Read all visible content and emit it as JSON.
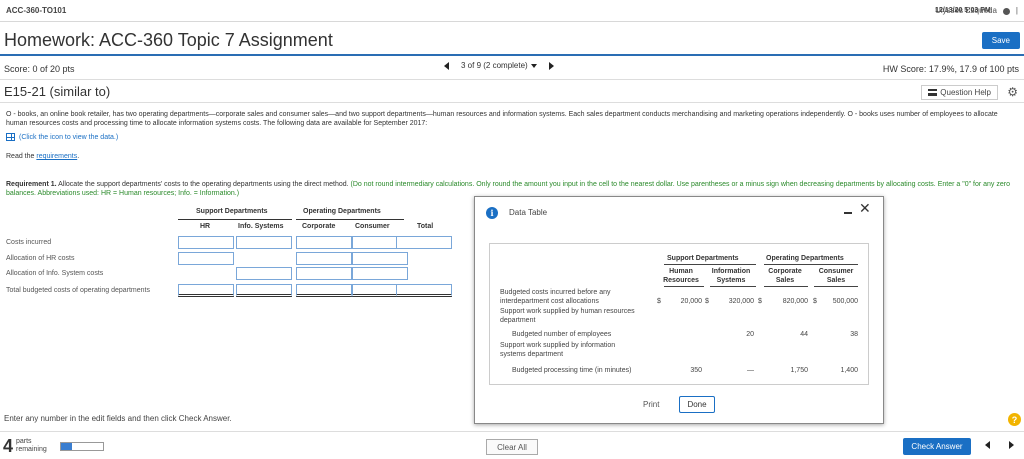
{
  "topbar": {
    "course": "ACC-360-TO101",
    "user": "Ulysses Esqueda",
    "divider": "|",
    "datetime": "12/13/20 5:03 PM"
  },
  "header": {
    "title": "Homework: ACC-360 Topic 7 Assignment",
    "save_label": "Save"
  },
  "scorebar": {
    "score": "Score: 0 of 20 pts",
    "pager": "3 of 9 (2 complete)",
    "hw_score": "HW Score: 17.9%, 17.9 of 100 pts"
  },
  "question": {
    "id": "E15-21 (similar to)",
    "help_label": "Question Help",
    "intro": "O - books, an online book retailer, has two operating departments—corporate sales and consumer sales—and two support departments—human resources and information systems. Each sales department conducts merchandising and marketing operations independently. O - books uses number of employees to allocate human resources costs and processing time to allocate information systems costs. The following data are available for September 2017:",
    "data_link": "(Click the icon to view the data.)",
    "read_prefix": "Read the ",
    "read_link": "requirements",
    "read_suffix": "."
  },
  "requirement": {
    "label": "Requirement 1.",
    "text": " Allocate the support departments' costs to the operating departments using the direct method. ",
    "note": "(Do not round intermediary calculations. Only round the amount you input in the cell to the nearest dollar. Use parentheses or a minus sign when decreasing departments by allocating costs. Enter a \"0\" for any zero balances. Abbreviations used: HR = Human resources; Info. = Information.)"
  },
  "worktable": {
    "group_support": "Support Departments",
    "group_operating": "Operating Departments",
    "col_hr": "HR",
    "col_info": "Info. Systems",
    "col_corporate": "Corporate",
    "col_consumer": "Consumer",
    "col_total": "Total",
    "rows": [
      "Costs incurred",
      "Allocation of HR costs",
      "Allocation of Info. System costs",
      "Total budgeted costs of operating departments"
    ]
  },
  "footer": {
    "hint": "Enter any number in the edit fields and then click Check Answer.",
    "parts_num": "4",
    "parts_label_1": "parts",
    "parts_label_2": "remaining",
    "progress_fraction": 0.25,
    "clear_all": "Clear All",
    "check_answer": "Check Answer",
    "help_q": "?"
  },
  "modal": {
    "title": "Data Table",
    "print": "Print",
    "done": "Done",
    "group_support": "Support Departments",
    "group_operating": "Operating Departments",
    "col_hr_1": "Human",
    "col_hr_2": "Resources",
    "col_info_1": "Information",
    "col_info_2": "Systems",
    "col_corp_1": "Corporate",
    "col_corp_2": "Sales",
    "col_cons_1": "Consumer",
    "col_cons_2": "Sales",
    "row1_label_1": "Budgeted costs incurred before any",
    "row1_label_2": "interdepartment cost allocations",
    "row1_dollar": "$",
    "row1": [
      "20,000",
      "320,000",
      "820,000",
      "500,000"
    ],
    "row2_label_1": "Support work supplied by human resources",
    "row2_label_2": "department",
    "row2_sub": "Budgeted number of employees",
    "row2": [
      "",
      "20",
      "44",
      "38"
    ],
    "row3_label_1": "Support work supplied by information",
    "row3_label_2": "systems department",
    "row3_sub": "Budgeted processing time (in minutes)",
    "row3": [
      "350",
      "—",
      "1,750",
      "1,400"
    ]
  }
}
